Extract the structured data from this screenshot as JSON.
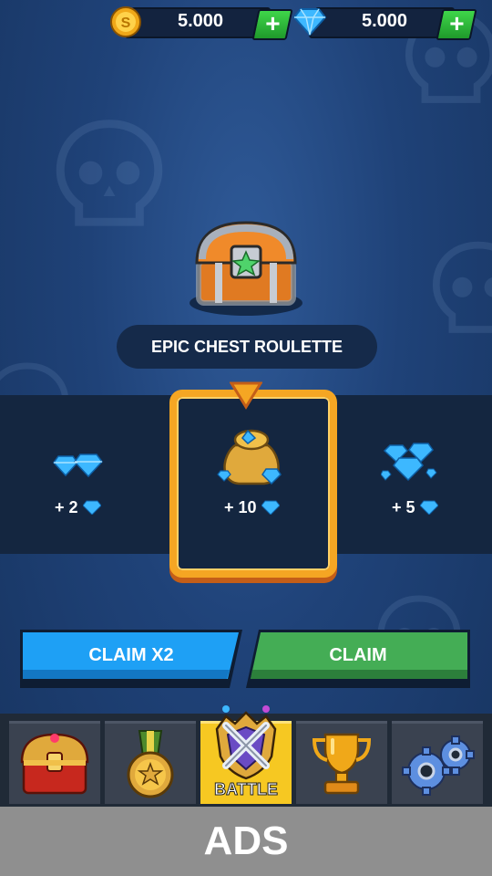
{
  "top_bar": {
    "coins": {
      "icon": "coin-icon",
      "value": "5.000",
      "plus": "+"
    },
    "gems": {
      "icon": "gem-icon",
      "value": "5.000",
      "plus": "+"
    }
  },
  "chest": {
    "icon": "treasure-chest-icon",
    "title": "EPIC CHEST ROULETTE"
  },
  "roulette": {
    "items": [
      {
        "icon": "gem-pile-small-icon",
        "label": "+ 2"
      },
      {
        "icon": "gem-bag-icon",
        "label": "+ 10"
      },
      {
        "icon": "gem-pile-icon",
        "label": "+ 5"
      }
    ]
  },
  "buttons": {
    "claim_x2": "CLAIM X2",
    "claim": "CLAIM"
  },
  "nav": {
    "tabs": [
      {
        "icon": "treasure-chest-icon",
        "label": ""
      },
      {
        "icon": "medal-icon",
        "label": ""
      },
      {
        "icon": "battle-crest-icon",
        "label": "BATTLE"
      },
      {
        "icon": "trophy-icon",
        "label": ""
      },
      {
        "icon": "gears-icon",
        "label": ""
      }
    ]
  },
  "ads": {
    "label": "ADS"
  },
  "colors": {
    "background": "#1f4278",
    "claim_x2": "#1e9bf0",
    "claim": "#3ea84f",
    "highlight": "#f5a623",
    "active_tab": "#f6c822"
  }
}
